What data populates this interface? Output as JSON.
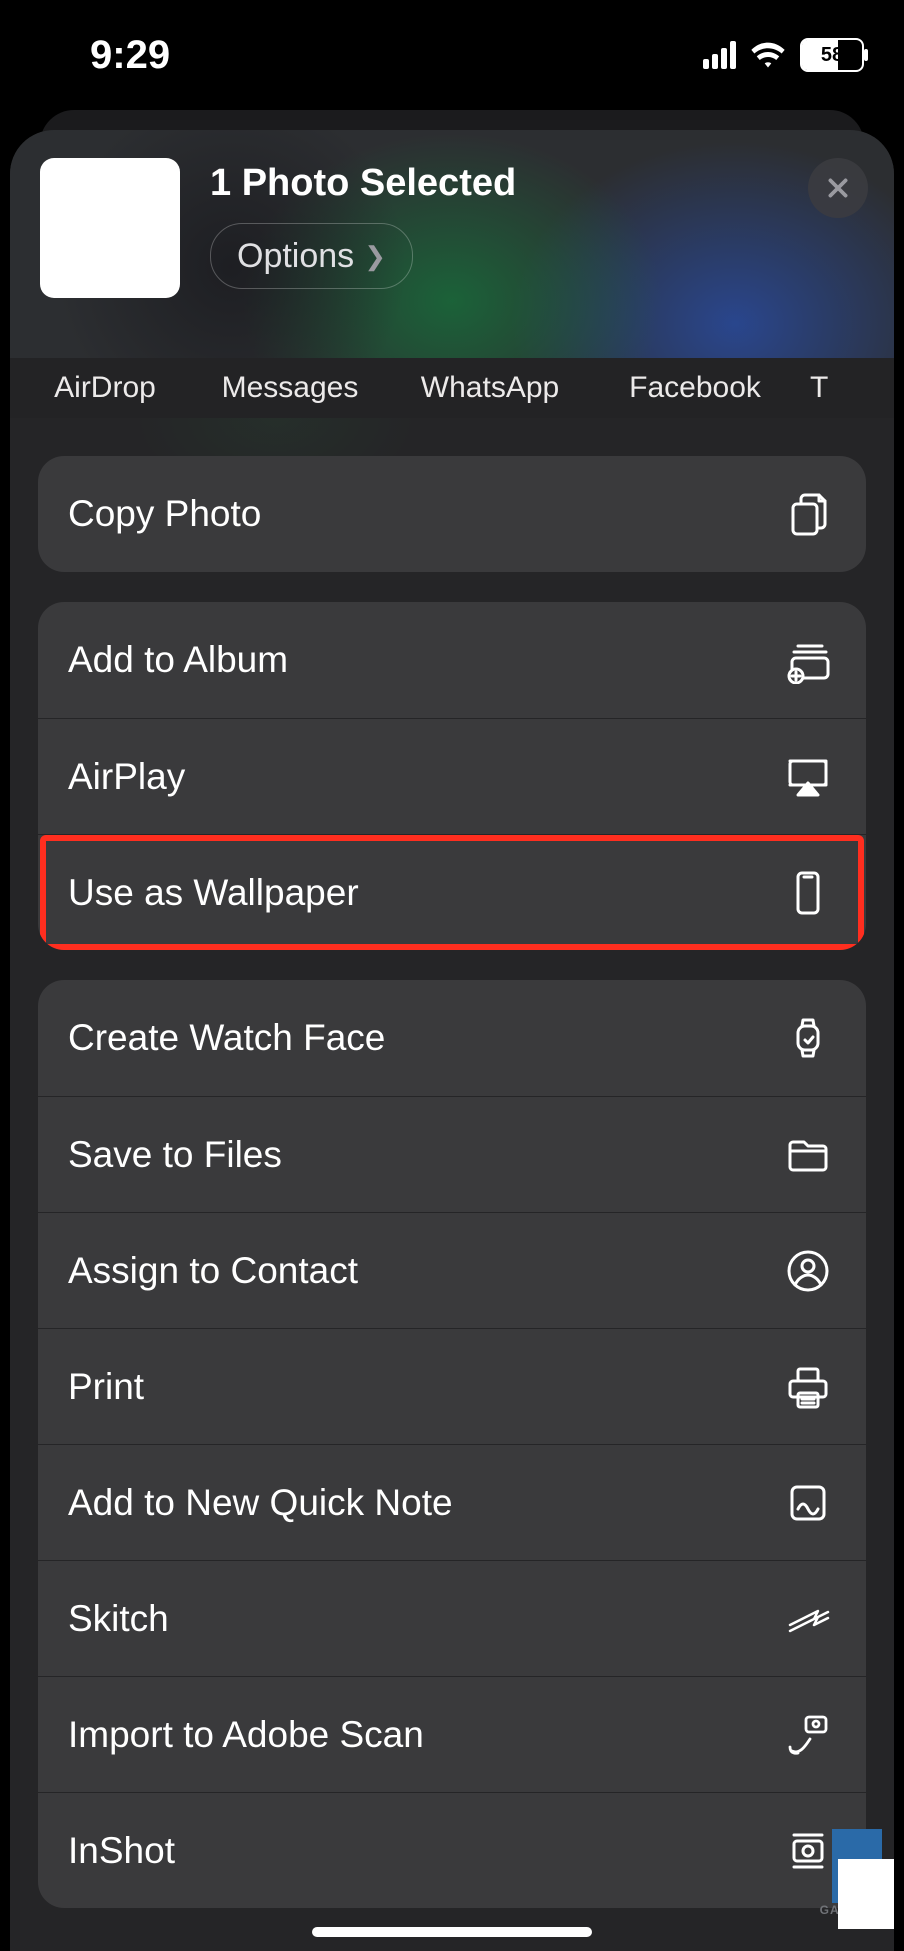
{
  "status": {
    "time": "9:29",
    "battery": "58"
  },
  "header": {
    "title": "1 Photo Selected",
    "options": "Options"
  },
  "apps": {
    "airdrop": "AirDrop",
    "messages": "Messages",
    "whatsapp": "WhatsApp",
    "facebook": "Facebook",
    "more": "T"
  },
  "actions": {
    "copy": "Copy Photo",
    "album": "Add to Album",
    "airplay": "AirPlay",
    "wallpaper": "Use as Wallpaper",
    "watchface": "Create Watch Face",
    "files": "Save to Files",
    "contact": "Assign to Contact",
    "print": "Print",
    "quicknote": "Add to New Quick Note",
    "skitch": "Skitch",
    "adobescan": "Import to Adobe Scan",
    "inshot": "InShot"
  },
  "watermark": "GADGETS"
}
